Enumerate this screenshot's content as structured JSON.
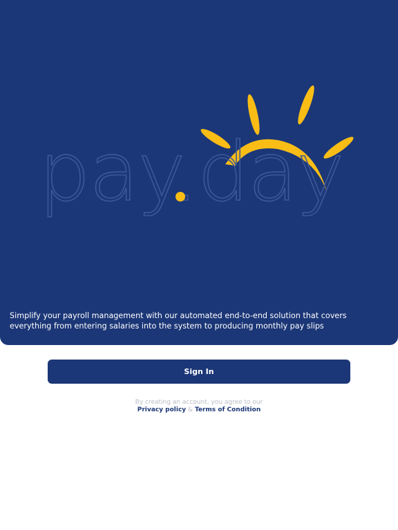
{
  "hero": {
    "logo_text": "pay.day",
    "tagline": "Simplify your payroll management with our automated end-to-end solution that covers everything from entering salaries into the system to producing monthly pay slips"
  },
  "auth": {
    "sign_in_label": "Sign In"
  },
  "legal": {
    "prefix": "By creating an account, you agree to our",
    "privacy_label": "Privacy policy",
    "separator": "&",
    "terms_label": "Terms of Condition"
  },
  "colors": {
    "brand_blue": "#1c3777",
    "sun_yellow": "#f9bd16"
  }
}
